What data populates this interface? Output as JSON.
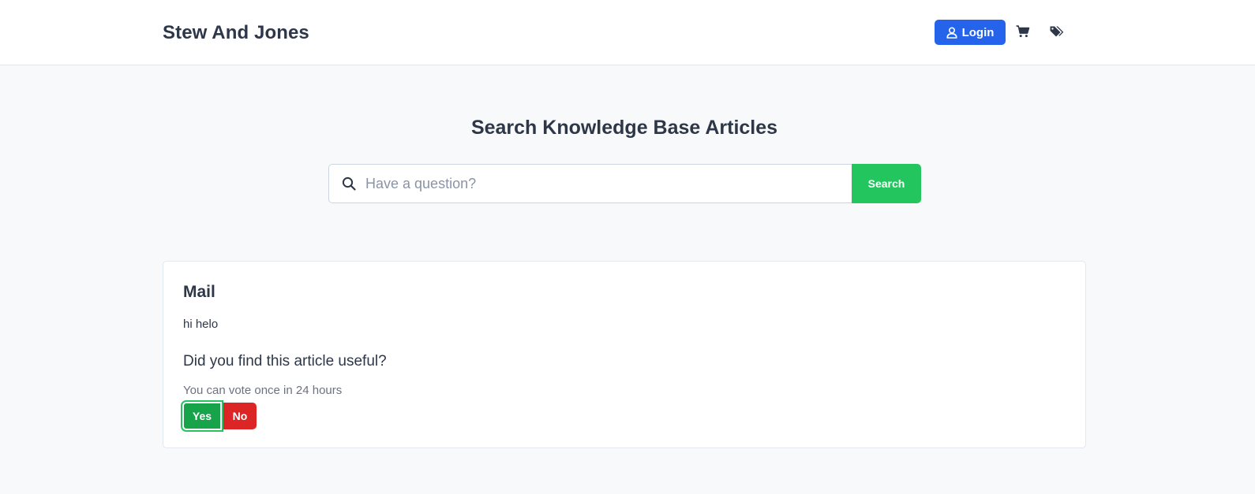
{
  "header": {
    "brand": "Stew And Jones",
    "login_label": "Login",
    "icons": [
      "user-icon",
      "cart-icon",
      "tags-icon"
    ],
    "login_color": "#2563eb"
  },
  "search": {
    "title": "Search Knowledge Base Articles",
    "placeholder": "Have a question?",
    "value": "",
    "button_label": "Search",
    "button_color": "#22c55e"
  },
  "article": {
    "title": "Mail",
    "body": "hi helo",
    "feedback_question": "Did you find this article useful?",
    "vote_note": "You can vote once in 24 hours",
    "yes_label": "Yes",
    "no_label": "No",
    "yes_color": "#16a34a",
    "no_color": "#dc2626"
  }
}
